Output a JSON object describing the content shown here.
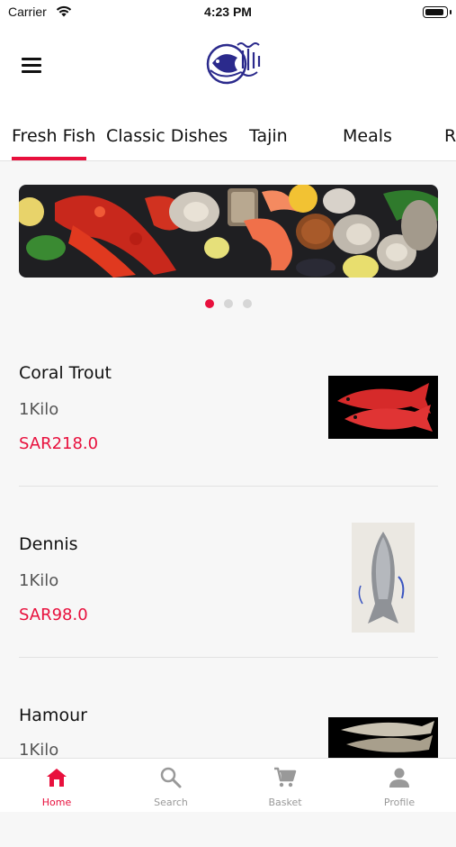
{
  "status_bar": {
    "carrier": "Carrier",
    "time": "4:23 PM"
  },
  "header": {
    "logo_icon": "fish-logo-icon",
    "menu_icon": "hamburger-menu-icon"
  },
  "categories": [
    {
      "label": "Fresh Fish",
      "active": true
    },
    {
      "label": "Classic Dishes",
      "active": false
    },
    {
      "label": "Tajin",
      "active": false
    },
    {
      "label": "Meals",
      "active": false
    },
    {
      "label": "Ri",
      "active": false
    }
  ],
  "carousel": {
    "page_count": 3,
    "active_index": 0
  },
  "products": [
    {
      "name": "Coral Trout",
      "unit": "1Kilo",
      "price": "SAR218.0"
    },
    {
      "name": "Dennis",
      "unit": "1Kilo",
      "price": "SAR98.0"
    },
    {
      "name": "Hamour",
      "unit": "1Kilo",
      "price": ""
    }
  ],
  "tabbar": {
    "items": [
      {
        "label": "Home",
        "icon": "home-icon",
        "active": true
      },
      {
        "label": "Search",
        "icon": "search-icon",
        "active": false
      },
      {
        "label": "Basket",
        "icon": "cart-icon",
        "active": false
      },
      {
        "label": "Profile",
        "icon": "profile-icon",
        "active": false
      }
    ]
  },
  "colors": {
    "accent": "#e8103d",
    "logo": "#2b2a8c",
    "background": "#f7f7f7"
  }
}
